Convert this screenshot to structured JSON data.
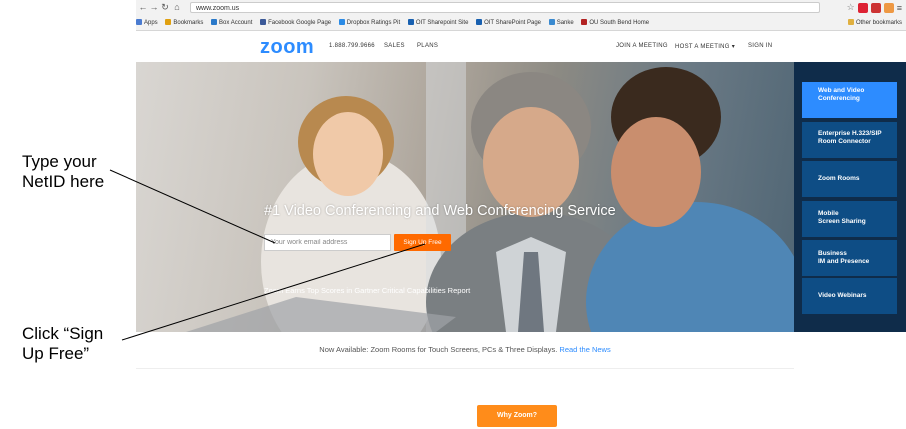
{
  "browser": {
    "url": "www.zoom.us",
    "bookmarks": [
      "Apps",
      "Bookmarks",
      "Box Account",
      "Facebook Google Page",
      "Dropbox Ratings Pit",
      "OIT Sharepoint Site",
      "OIT SharePoint Page",
      "Sanke",
      "OU South Bend Home"
    ],
    "other_bookmarks": "Other bookmarks"
  },
  "header": {
    "logo": "zoom",
    "phone": "1.888.799.9666",
    "nav_sales": "SALES",
    "nav_plans": "PLANS",
    "nav_join": "JOIN A MEETING",
    "nav_host": "HOST A MEETING ▾",
    "nav_signin": "SIGN IN"
  },
  "hero": {
    "headline": "#1 Video Conferencing and Web Conferencing Service",
    "email_placeholder": "Your work email address",
    "signup_label": "Sign Up Free",
    "report_text": "Zoom Earns Top Scores in Gartner Critical Capabilities Report"
  },
  "side_menu": {
    "items": [
      {
        "line1": "Web and Video",
        "line2": "Conferencing"
      },
      {
        "line1": "Enterprise H.323/SIP",
        "line2": "Room Connector"
      },
      {
        "line1": "Zoom Rooms",
        "line2": ""
      },
      {
        "line1": "Mobile",
        "line2": "Screen Sharing"
      },
      {
        "line1": "Business",
        "line2": "IM and Presence"
      },
      {
        "line1": "Video Webinars",
        "line2": ""
      }
    ]
  },
  "notice": {
    "text": "Now Available: Zoom Rooms for Touch Screens, PCs & Three Displays.",
    "link": "Read the News"
  },
  "why_button": "Why Zoom?",
  "annotations": {
    "netid_line1": "Type your",
    "netid_line2": "NetID here",
    "click_line1": "Click “Sign",
    "click_line2": "Up Free”"
  },
  "colors": {
    "brand_blue": "#2d8cff",
    "signup_orange": "#ff6a00",
    "side_bg": "#0f2c4a"
  }
}
